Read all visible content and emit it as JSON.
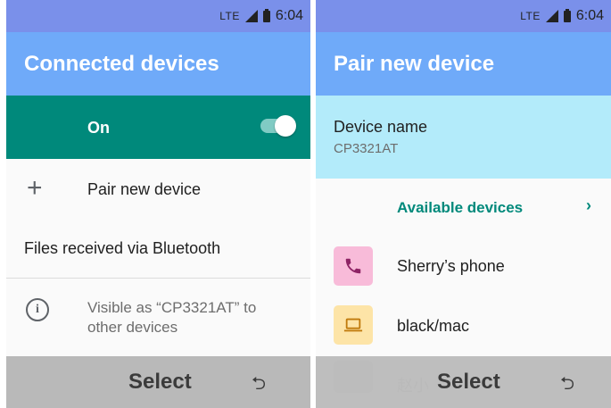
{
  "status": {
    "network": "LTE",
    "time": "6:04"
  },
  "left": {
    "title": "Connected devices",
    "toggle": {
      "label": "On",
      "state": "on"
    },
    "pair": "Pair new device",
    "files": "Files received via Bluetooth",
    "visible_line1": "Visible as “CP3321AT” to",
    "visible_line2": "other devices"
  },
  "right": {
    "title": "Pair new device",
    "device_name_label": "Device name",
    "device_name_value": "CP3321AT",
    "available_label": "Available devices",
    "devices": [
      {
        "name": "Sherry’s phone",
        "icon": "phone-icon",
        "bg": "#f8bbd9",
        "fg": "#8e2465"
      },
      {
        "name": "black/mac",
        "icon": "laptop-icon",
        "bg": "#fde4a7",
        "fg": "#c07a0c"
      }
    ],
    "partial_device": "赵小"
  },
  "softkeys": {
    "select": "Select",
    "back": "back-arrow-icon"
  },
  "colors": {
    "status_bar": "#7a90ea",
    "app_bar": "#6faaf9",
    "teal": "#00897b",
    "name_block": "#b3ebfa",
    "softkey_bar": "#b9b9b9"
  }
}
